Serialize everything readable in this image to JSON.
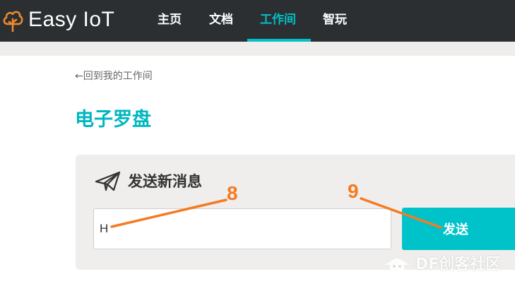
{
  "app": {
    "brand": "Easy IoT"
  },
  "nav": {
    "items": [
      {
        "label": "主页"
      },
      {
        "label": "文档"
      },
      {
        "label": "工作间"
      },
      {
        "label": "智玩"
      }
    ],
    "active_index": 2
  },
  "page": {
    "back_link": "←回到我的工作间",
    "title": "电子罗盘"
  },
  "send_panel": {
    "title": "发送新消息",
    "input_value": "H",
    "button_label": "发送"
  },
  "annotations": [
    {
      "label": "8"
    },
    {
      "label": "9"
    }
  ],
  "watermark": {
    "text": "DF创客社区"
  },
  "colors": {
    "nav_bg": "#2b2f32",
    "accent": "#00c1c9",
    "panel_bg": "#efeeec",
    "annotation": "#f47b22"
  },
  "icons": {
    "logo": "cloud-tree-icon",
    "panel": "paper-plane-icon"
  }
}
